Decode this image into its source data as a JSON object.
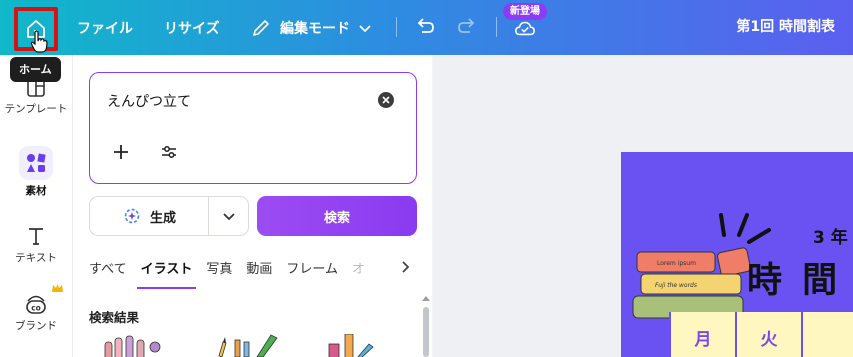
{
  "topbar": {
    "menu": [
      "ファイル",
      "リサイズ"
    ],
    "edit_mode": "編集モード",
    "new_badge": "新登場",
    "doc_title": "第1回 時間割表",
    "colors": {
      "gradient_start": "#10b8c9",
      "gradient_end": "#5b5ff0",
      "badge": "#8b3df5",
      "highlight": "#d41414"
    }
  },
  "tooltip": "ホーム",
  "rail": {
    "items": [
      {
        "label": "テンプレート",
        "icon": "template-icon"
      },
      {
        "label": "素材",
        "icon": "elements-icon"
      },
      {
        "label": "テキスト",
        "icon": "text-icon"
      },
      {
        "label": "ブランド",
        "icon": "brand-icon"
      }
    ]
  },
  "panel": {
    "search_value": "えんぴつ立て",
    "generate_label": "生成",
    "search_label": "検索",
    "tabs": [
      "すべて",
      "イラスト",
      "写真",
      "動画",
      "フレーム",
      "オ"
    ],
    "active_tab": "イラスト",
    "section_title": "検索結果"
  },
  "canvas": {
    "year": "3 年",
    "title": "時 間",
    "days": [
      "月",
      "火"
    ],
    "book_labels": [
      "Lorem ipsum",
      "Fuji the words"
    ],
    "colors": {
      "page_bg": "#6a52f2",
      "cell_bg": "#fff7bf",
      "day_text": "#7a48ee"
    }
  }
}
